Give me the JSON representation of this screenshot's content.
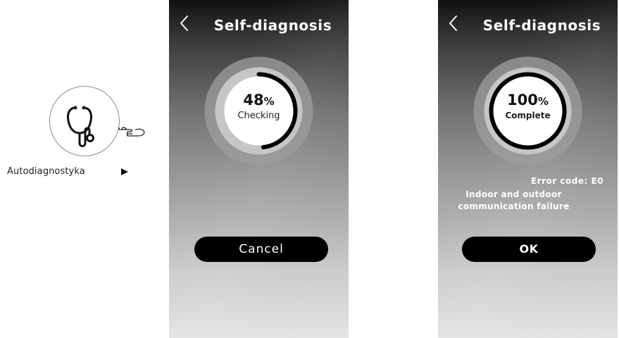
{
  "legend": {
    "icon": "stethoscope-icon",
    "pointer_icon": "pointing-hand-icon",
    "label": "Autodiagnostyka",
    "arrow_icon": "play-triangle-icon"
  },
  "screens": [
    {
      "back_icon": "chevron-left-icon",
      "title": "Self-diagnosis",
      "progress": {
        "percent": "48",
        "unit": "%",
        "fraction": 0.48,
        "status": "Checking"
      },
      "button_label": "Cancel"
    },
    {
      "back_icon": "chevron-left-icon",
      "title": "Self-diagnosis",
      "progress": {
        "percent": "100",
        "unit": "%",
        "fraction": 1.0,
        "status": "Complete"
      },
      "error_code": "Error code:  E0",
      "error_lines": [
        "Indoor and outdoor",
        "communication failure"
      ],
      "button_label": "OK"
    }
  ],
  "colors": {
    "ring_progress": "#000000",
    "ring_outer": "#a6a6a6",
    "button_bg": "#000000",
    "title_text": "#ffffff"
  }
}
